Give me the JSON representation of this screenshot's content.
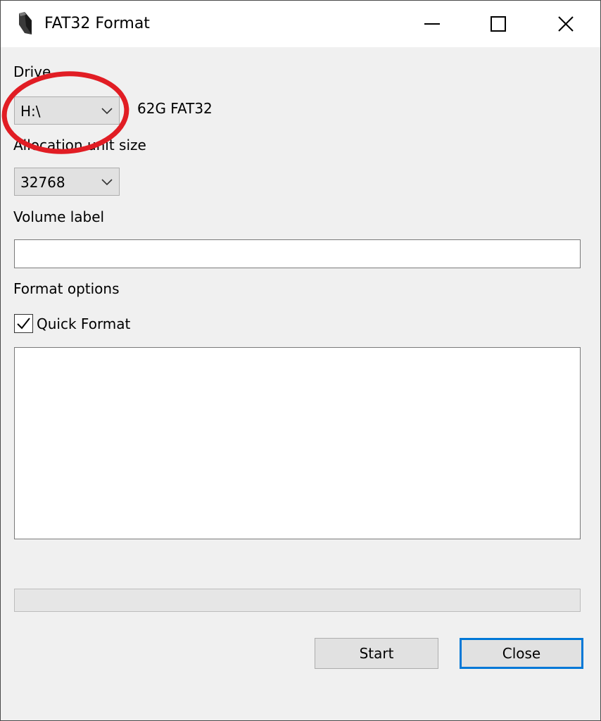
{
  "window": {
    "title": "FAT32 Format",
    "app_icon": "usb-drive-icon",
    "controls": {
      "minimize": "minimize-icon",
      "maximize": "maximize-icon",
      "close": "close-icon"
    }
  },
  "drive": {
    "label": "Drive",
    "value": "H:\\",
    "info": "62G FAT32"
  },
  "allocation": {
    "label": "Allocation unit size",
    "value": "32768"
  },
  "volume": {
    "label": "Volume label",
    "value": ""
  },
  "format_options": {
    "label": "Format options",
    "quick_format_label": "Quick Format",
    "quick_format_checked": true
  },
  "log": {
    "text": ""
  },
  "progress": {
    "value": 0
  },
  "buttons": {
    "start": "Start",
    "close": "Close"
  },
  "colors": {
    "annotation": "#e11d24",
    "focus_border": "#0078d7",
    "window_bg": "#f0f0f0"
  }
}
